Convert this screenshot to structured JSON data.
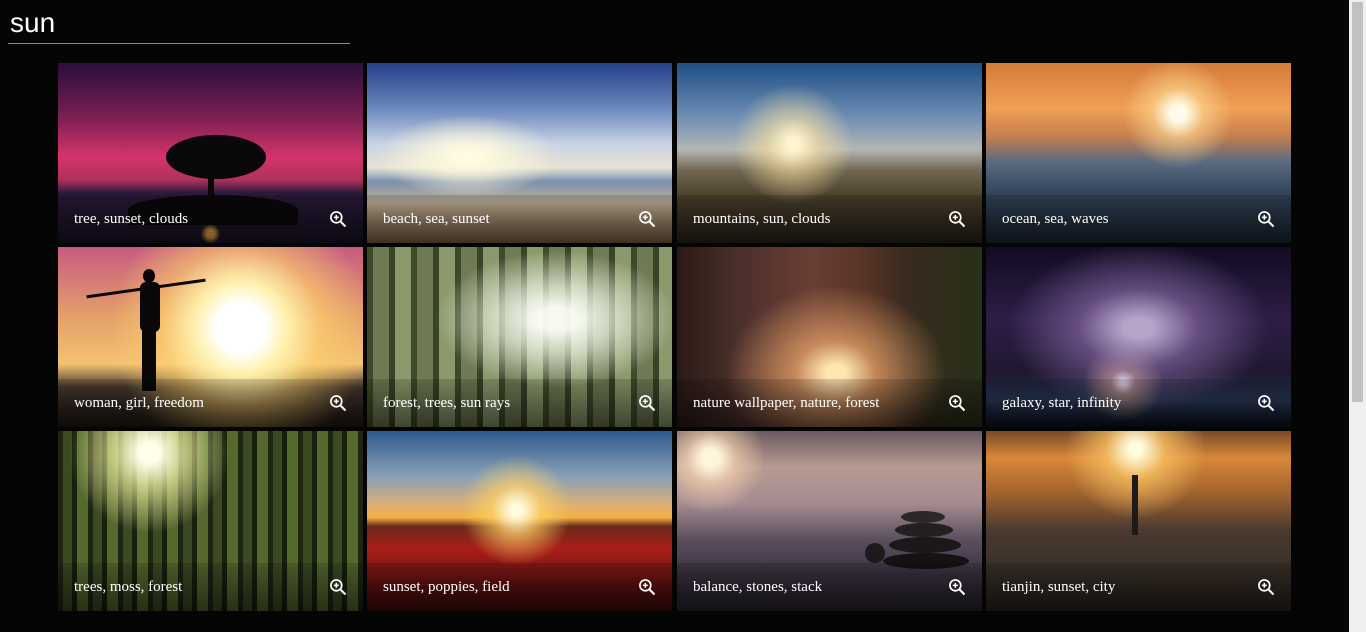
{
  "search": {
    "value": "sun",
    "placeholder": ""
  },
  "tiles": [
    {
      "caption": "tree, sunset, clouds",
      "icon": "zoom-in-icon"
    },
    {
      "caption": "beach, sea, sunset",
      "icon": "zoom-in-icon"
    },
    {
      "caption": "mountains, sun, clouds",
      "icon": "zoom-in-icon"
    },
    {
      "caption": "ocean, sea, waves",
      "icon": "zoom-in-icon"
    },
    {
      "caption": "woman, girl, freedom",
      "icon": "zoom-in-icon"
    },
    {
      "caption": "forest, trees, sun rays",
      "icon": "zoom-in-icon"
    },
    {
      "caption": "nature wallpaper, nature, forest",
      "icon": "zoom-in-icon"
    },
    {
      "caption": "galaxy, star, infinity",
      "icon": "zoom-in-icon"
    },
    {
      "caption": "trees, moss, forest",
      "icon": "zoom-in-icon"
    },
    {
      "caption": "sunset, poppies, field",
      "icon": "zoom-in-icon"
    },
    {
      "caption": "balance, stones, stack",
      "icon": "zoom-in-icon"
    },
    {
      "caption": "tianjin, sunset, city",
      "icon": "zoom-in-icon"
    }
  ],
  "colors": {
    "background": "#050505",
    "text": "#ffffff",
    "underline": "#8a8a8a"
  }
}
